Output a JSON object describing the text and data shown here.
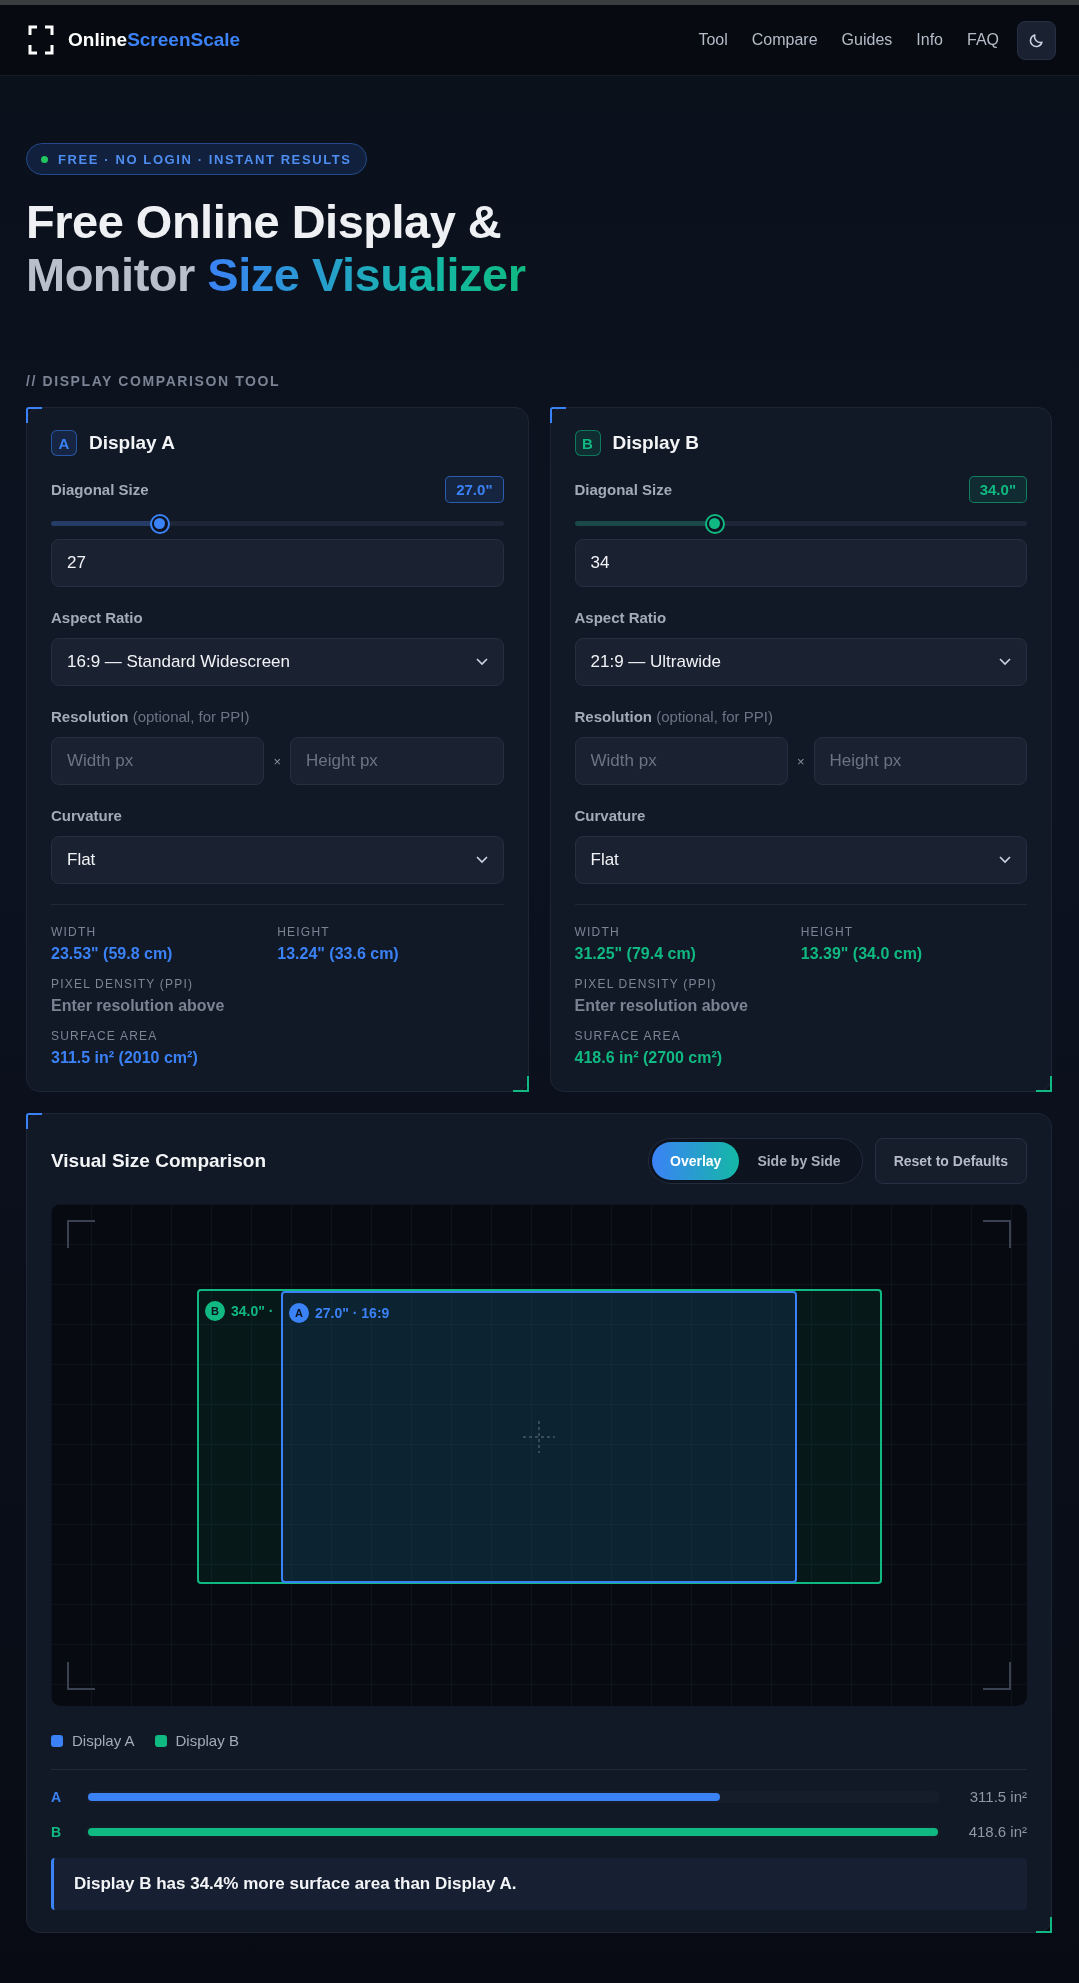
{
  "header": {
    "brand": [
      {
        "text": "Online",
        "accent": false
      },
      {
        "text": "ScreenScale",
        "accent": true
      }
    ],
    "nav": [
      "Tool",
      "Compare",
      "Guides",
      "Info",
      "FAQ"
    ]
  },
  "hero": {
    "badge": "FREE · NO LOGIN · INSTANT RESULTS",
    "title_line_1": "Free Online Display &",
    "title_line_2": "Monitor",
    "title_highlight": "Size Visualizer"
  },
  "section_label": "// DISPLAY COMPARISON TOOL",
  "displays": [
    {
      "letter": "A",
      "title": "Display A",
      "color": "#3b82f6",
      "diagonal_label": "Diagonal Size",
      "diagonal_badge": "27.0\"",
      "level": 0.24,
      "diagonal_value": "27",
      "aspect_label": "Aspect Ratio",
      "aspect_value": "16:9 — Standard Widescreen",
      "resolution_label": "**Resolution** (optional, for PPI)",
      "width_placeholder": "Width px",
      "times": "×",
      "height_placeholder": "Height px",
      "curvature_label": "Curvature",
      "curvature_value": "Flat",
      "stats": [
        {
          "label": "WIDTH",
          "value": "23.53\" (59.8 cm)",
          "kind": "measure",
          "wide": false
        },
        {
          "label": "HEIGHT",
          "value": "13.24\" (33.6 cm)",
          "kind": "measure",
          "wide": false
        },
        {
          "label": "PIXEL DENSITY (PPI)",
          "value": "Enter resolution above",
          "kind": "hint",
          "wide": true
        },
        {
          "label": "SURFACE AREA",
          "value": "311.5 in² (2010 cm²)",
          "kind": "measure",
          "wide": true
        }
      ]
    },
    {
      "letter": "B",
      "title": "Display B",
      "color": "#10b981",
      "diagonal_label": "Diagonal Size",
      "diagonal_badge": "34.0\"",
      "level": 0.31,
      "diagonal_value": "34",
      "aspect_label": "Aspect Ratio",
      "aspect_value": "21:9 — Ultrawide",
      "resolution_label": "**Resolution** (optional, for PPI)",
      "width_placeholder": "Width px",
      "times": "×",
      "height_placeholder": "Height px",
      "curvature_label": "Curvature",
      "curvature_value": "Flat",
      "stats": [
        {
          "label": "WIDTH",
          "value": "31.25\" (79.4 cm)",
          "kind": "measure",
          "wide": false
        },
        {
          "label": "HEIGHT",
          "value": "13.39\" (34.0 cm)",
          "kind": "measure",
          "wide": false
        },
        {
          "label": "PIXEL DENSITY (PPI)",
          "value": "Enter resolution above",
          "kind": "hint",
          "wide": true
        },
        {
          "label": "SURFACE AREA",
          "value": "418.6 in² (2700 cm²)",
          "kind": "measure",
          "wide": true
        }
      ]
    }
  ],
  "comparison": {
    "title": "Visual Size Comparison",
    "modes": [
      {
        "label": "Overlay",
        "selected": true
      },
      {
        "label": "Side by Side",
        "selected": false
      }
    ],
    "reset": "Reset to Defaults",
    "overlay": [
      {
        "letter": "B",
        "label": "34.0\" ·",
        "color": "#10b981"
      },
      {
        "letter": "A",
        "label": "27.0\" · 16:9",
        "color": "#3b82f6"
      }
    ],
    "legend": [
      {
        "label": "Display A",
        "color": "#3b82f6"
      },
      {
        "label": "Display B",
        "color": "#10b981"
      }
    ],
    "bars": [
      {
        "letter": "A",
        "level": 0.744,
        "reading": "311.5 in²",
        "color": "#3b82f6"
      },
      {
        "letter": "B",
        "level": 1.0,
        "reading": "418.6 in²",
        "color": "#10b981"
      }
    ],
    "summary": "Display B has 34.4% more surface area than Display A."
  }
}
